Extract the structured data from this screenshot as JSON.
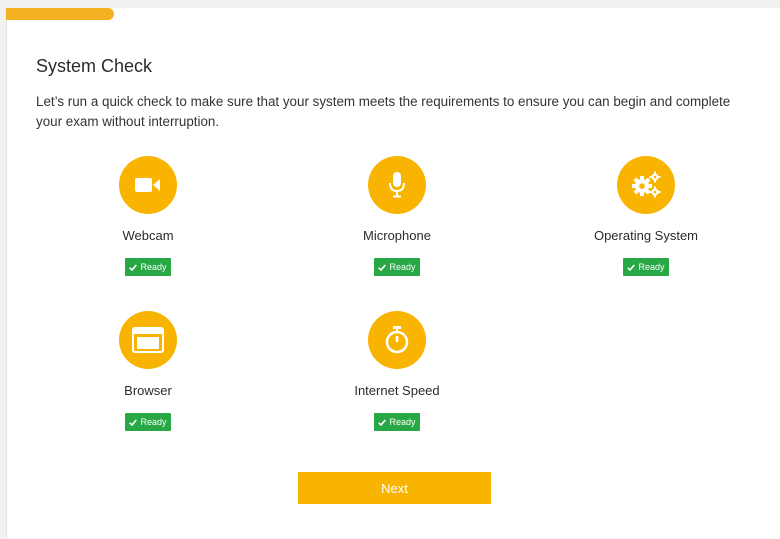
{
  "progress": {
    "value": 0.14
  },
  "header": {
    "title": "System Check",
    "description": "Let’s run a quick check to make sure that your system meets the requirements to ensure you can begin and complete your exam without interruption."
  },
  "checks": [
    {
      "label": "Webcam",
      "icon": "video-camera-icon",
      "status": "Ready"
    },
    {
      "label": "Microphone",
      "icon": "microphone-icon",
      "status": "Ready"
    },
    {
      "label": "Operating System",
      "icon": "gears-icon",
      "status": "Ready"
    },
    {
      "label": "Browser",
      "icon": "browser-window-icon",
      "status": "Ready"
    },
    {
      "label": "Internet Speed",
      "icon": "stopwatch-icon",
      "status": "Ready"
    }
  ],
  "actions": {
    "next_label": "Next"
  },
  "colors": {
    "accent": "#f8b400",
    "progress": "#f5b122",
    "ready": "#28a745"
  }
}
